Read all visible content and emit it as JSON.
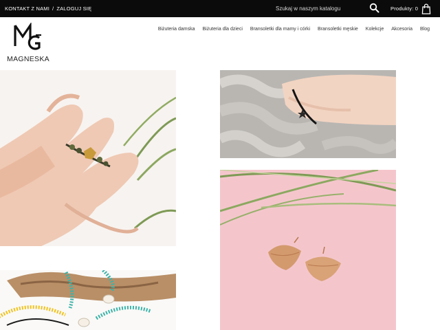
{
  "topbar": {
    "contact_label": "KONTAKT Z NAMI",
    "separator": "/",
    "login_label": "ZALOGUJ SIĘ",
    "search_placeholder": "Szukaj w naszym katalogu",
    "cart_label": "Produkty: 0",
    "search_icon": "search-icon",
    "cart_icon": "shopping-bag-icon"
  },
  "header": {
    "logo_monogram": "MG",
    "logo_word": "MAGNESKA"
  },
  "nav": {
    "items": [
      "Biżuteria damska",
      "Biżuteria dla dzieci",
      "Bransoletki dla mamy i córki",
      "Bransoletki męskie",
      "Kolekcje",
      "Akcesoria",
      "Blog"
    ]
  },
  "gallery": {
    "tiles": [
      "ring-photo",
      "bracelet-sweater-photo",
      "leaf-earrings-photo",
      "shell-bracelets-photo"
    ]
  },
  "colors": {
    "topbar_bg": "#0b0b0b",
    "text_light": "#ffffff",
    "nav_text": "#333333",
    "earrings_bg": "#f4c6cc",
    "gold": "#d39a6e"
  }
}
